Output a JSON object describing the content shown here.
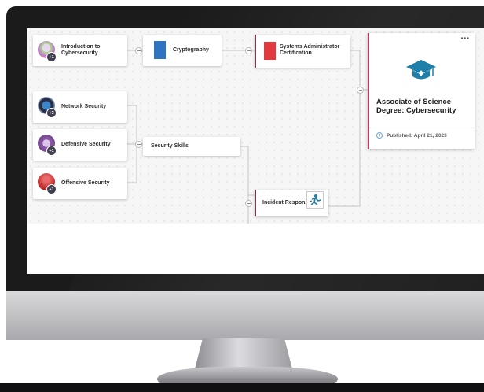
{
  "pathway": {
    "nodes": {
      "intro": {
        "label": "Introduction to Cybersecurity",
        "count": "+1"
      },
      "crypto": {
        "label": "Cryptography"
      },
      "sysadmin": {
        "label": "Systems Administrator Certification"
      },
      "network": {
        "label": "Network Security",
        "count": "+3"
      },
      "defensive": {
        "label": "Defensive Security",
        "count": "+1"
      },
      "offensive": {
        "label": "Offensive Security",
        "count": "+1"
      },
      "skills": {
        "label": "Security Skills"
      },
      "incident": {
        "label": "Incident Response"
      }
    },
    "degree": {
      "title": "Associate of Science Degree: Cybersecurity",
      "published": "Published: April 21, 2023",
      "more": "•••",
      "icon": "graduation-cap-icon"
    }
  },
  "colors": {
    "crypto_icon": "#2f74c0",
    "sysadmin_icon": "#e0393e",
    "degree_accent": "#c0395a",
    "cap_icon": "#1f7fa8",
    "monitor_accent": "#f3c300"
  }
}
